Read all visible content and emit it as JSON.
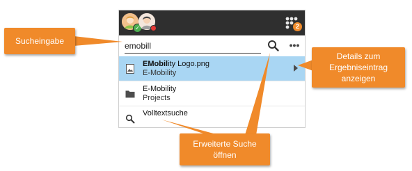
{
  "search": {
    "value": "emobill",
    "search_icon": "magnifier-icon",
    "more_label": "•••"
  },
  "header": {
    "apps_badge_count": "2",
    "status_ok_glyph": "✓"
  },
  "results": [
    {
      "title_bold": "EMobil",
      "title_rest": "ity Logo.png",
      "subtitle": "E-Mobility",
      "icon": "image-file-icon",
      "selected": true
    },
    {
      "title": "E-Mobility",
      "subtitle": "Projects",
      "icon": "folder-icon"
    },
    {
      "title": "Volltextsuche",
      "icon": "magnifier-icon"
    }
  ],
  "callouts": {
    "search_input": "Sucheingabe",
    "details_line1": "Details zum",
    "details_line2": "Ergebniseintrag",
    "details_line3": "anzeigen",
    "advanced_line1": "Erweiterte Suche",
    "advanced_line2": "öffnen"
  },
  "colors": {
    "callout": "#f08a2a",
    "selected_row": "#a9d6f3",
    "topbar": "#2f2f2f",
    "badge": "#f08c2c"
  }
}
